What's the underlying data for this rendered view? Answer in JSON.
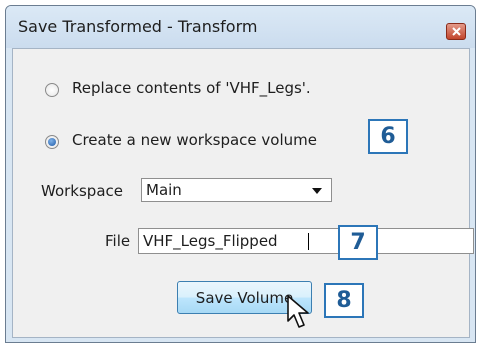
{
  "dialog": {
    "title": "Save Transformed - Transform",
    "options": [
      {
        "label": "Replace contents of 'VHF_Legs'.",
        "selected": false
      },
      {
        "label": "Create a new workspace volume",
        "selected": true
      }
    ],
    "workspace": {
      "label": "Workspace",
      "value": "Main"
    },
    "file": {
      "label": "File",
      "value": "VHF_Legs_Flipped"
    },
    "save_button": "Save Volume"
  },
  "callouts": [
    "6",
    "7",
    "8"
  ],
  "colors": {
    "accent": "#2c76b8",
    "callout_text": "#1f5c96",
    "close_button": "#c2452c"
  },
  "icons": {
    "close": "close-icon",
    "cursor": "mouse-pointer-icon",
    "dropdown": "chevron-down-icon"
  }
}
